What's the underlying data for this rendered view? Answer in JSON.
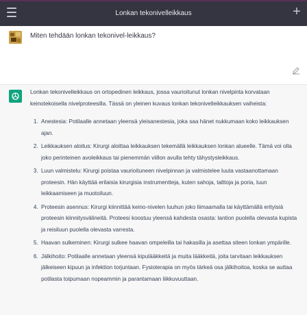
{
  "header": {
    "title": "Lonkan tekonivelleikkaus",
    "accent_color": "#5a2f56",
    "background_color": "#343541",
    "menu_icon": "hamburger-icon",
    "new_chat_icon": "plus-icon"
  },
  "user_message": {
    "text": "Miten tehdään lonkan tekonivel-leikkaus?",
    "edit_icon": "edit-icon"
  },
  "assistant_message": {
    "intro": "Lonkan tekonivelleikkaus on ortopedinen leikkaus, jossa vaurioitunut lonkan nivelpinta korvataan keinotekoisella nivelproteesilla. Tässä on yleinen kuvaus lonkan tekonivelleikkauksen vaiheista:",
    "steps": [
      "Anestesia: Potilaalle annetaan yleensä yleisanestesia, joka saa hänet nukkumaan koko leikkauksen ajan.",
      "Leikkauksen aloitus: Kirurgi aloittaa leikkauksen tekemällä leikkauksen lonkan alueelle. Tämä voi olla joko perinteinen avoleikkaus tai pienemmän viillon avulla tehty tähystysleikkaus.",
      "Luun valmistelu: Kirurgi poistaa vaurioituneen nivelpinnan ja valmistelee luuta vastaanottamaan proteesin. Hän käyttää erilaisia kirurgisia instrumentteja, kuten sahoja, talttoja ja poria, luun leikkaamiseen ja muotoiluun.",
      "Proteesin asennus: Kirurgi kiinnittää keino-nivelen luuhun joko liimaamalla tai käyttämällä erityisiä proteesin kiinnitysvälineitä. Proteesi koostuu yleensä kahdesta osasta: lantion puolella olevasta kupista ja reisiluun puolella olevasta varresta.",
      "Haavan sulkeminen: Kirurgi sulkee haavan ompeleilla tai hakasilla ja asettaa siteen lonkan ympärille.",
      "Jälkihoito: Potilaalle annetaan yleensä kipulääkkeitä ja muita lääkkeitä, joita tarvitaan leikkauksen jälkeiseen kipuun ja infektion torjuntaan. Fysioterapia on myös tärkeä osa jälkihoitoa, koska se auttaa potilasta toipumaan nopeammin ja parantamaan liikkuvuuttaan."
    ],
    "logo_icon": "openai-logo-icon",
    "logo_color": "#10a37f"
  }
}
